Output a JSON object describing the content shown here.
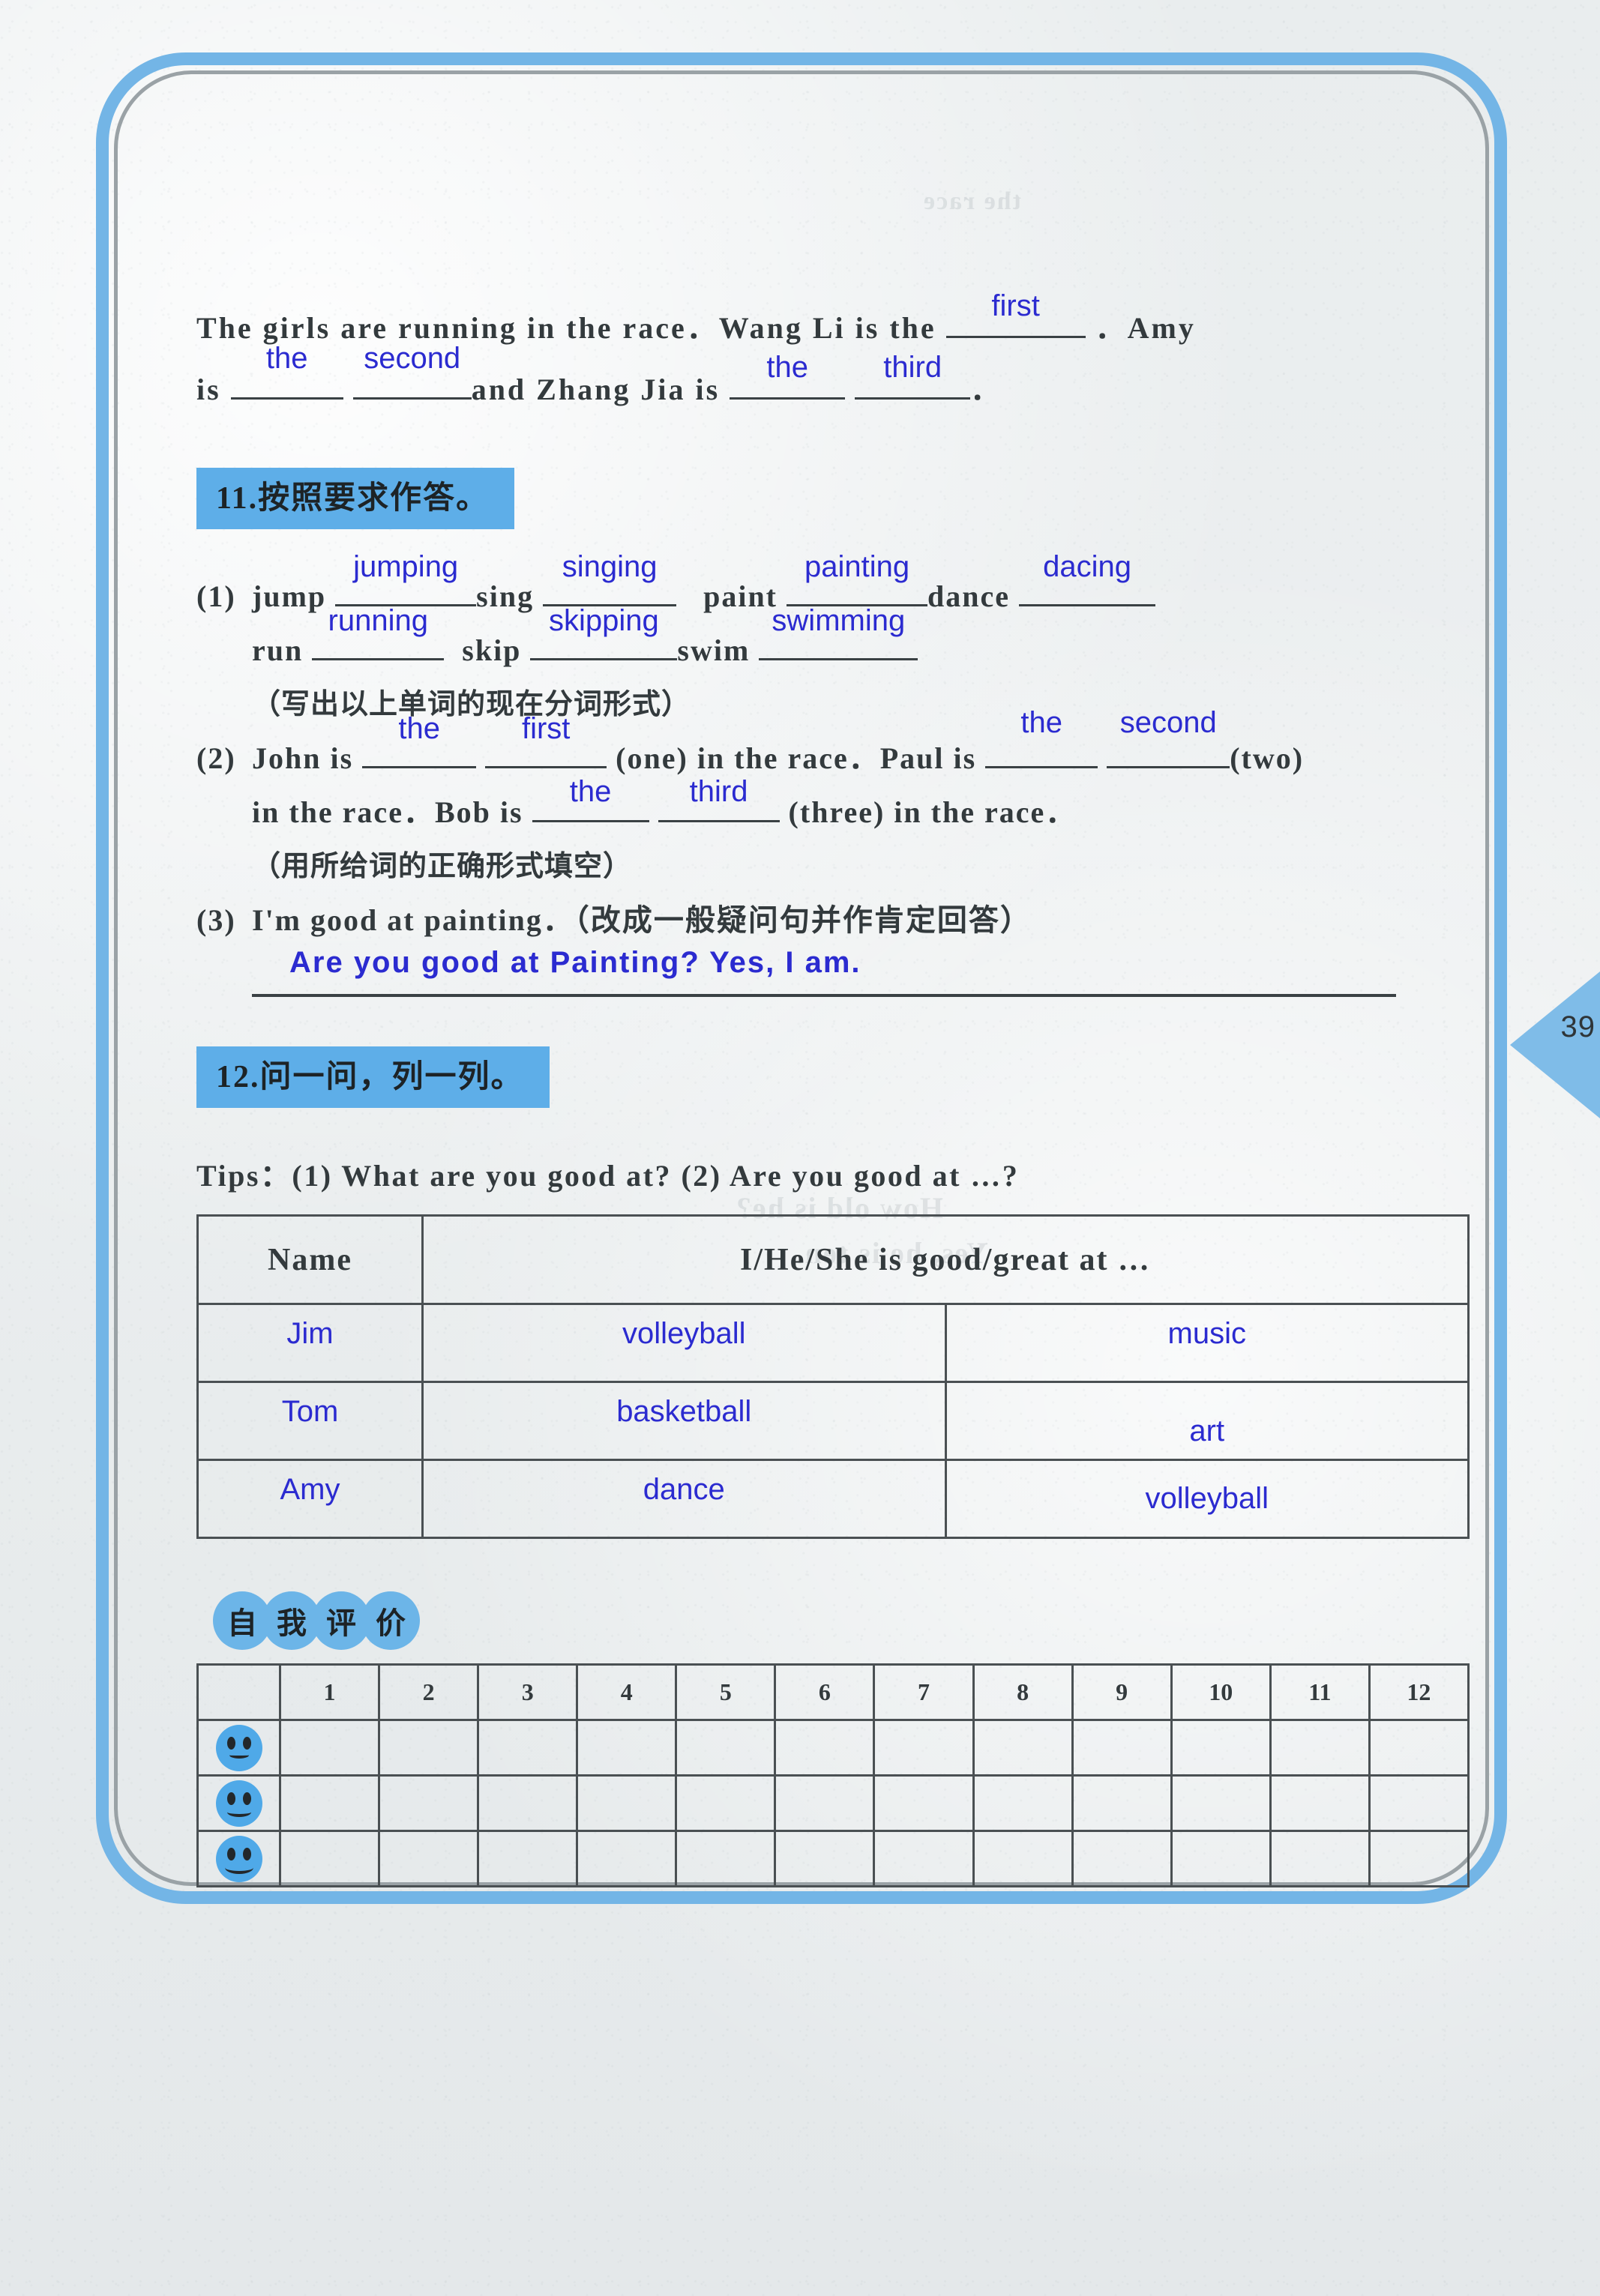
{
  "page": {
    "number": "39"
  },
  "bleed_text": {
    "line1": "How old is he?",
    "line2": "Yes, he is ten.",
    "line3": "the race"
  },
  "intro": {
    "seg1": "The girls are running in the race．Wang Li is the",
    "blank1": "first",
    "seg2": "．Amy",
    "seg3": "is",
    "blank2": "the",
    "blank3": "second",
    "seg4": "and Zhang Jia is",
    "blank4": "the",
    "blank5": "third",
    "seg5": "．"
  },
  "section11": {
    "banner": "11.按照要求作答。",
    "q1": {
      "num": "(1)",
      "prompts_line1": [
        {
          "word": "jump",
          "answer": "jumping"
        },
        {
          "word": "sing",
          "answer": "singing"
        },
        {
          "word": "paint",
          "answer": "painting"
        },
        {
          "word": "dance",
          "answer": "dacing"
        }
      ],
      "prompts_line2": [
        {
          "word": "run",
          "answer": "running"
        },
        {
          "word": "skip",
          "answer": "skipping"
        },
        {
          "word": "swim",
          "answer": "swimming"
        }
      ],
      "instruction": "（写出以上单词的现在分词形式）"
    },
    "q2": {
      "num": "(2)",
      "seg1": "John is",
      "blank1": "the",
      "blank2": "first",
      "seg2": "(one) in the race．Paul is",
      "blank3": "the",
      "blank4": "second",
      "seg3": "(two)",
      "seg4": "in the race．Bob is",
      "blank5": "the",
      "blank6": "third",
      "seg5": "(three) in the race．",
      "instruction": "（用所给词的正确形式填空）"
    },
    "q3": {
      "num": "(3)",
      "text": "I'm good at painting．（改成一般疑问句并作肯定回答）",
      "answer": "Are you good at Painting? Yes, I am."
    }
  },
  "section12": {
    "banner": "12.问一问，列一列。",
    "tips": "Tips：(1) What are you good at? (2) Are you good at …?",
    "table": {
      "headers": [
        "Name",
        "I/He/She is good/great at …"
      ],
      "rows": [
        {
          "name": "Jim",
          "col1": "volleyball",
          "col2": "music"
        },
        {
          "name": "Tom",
          "col1": "basketball",
          "col2": "art"
        },
        {
          "name": "Amy",
          "col1": "dance",
          "col2": "volleyball"
        }
      ]
    }
  },
  "self_eval": {
    "label_chars": [
      "自",
      "我",
      "评",
      "价"
    ],
    "numbers": [
      "1",
      "2",
      "3",
      "4",
      "5",
      "6",
      "7",
      "8",
      "9",
      "10",
      "11",
      "12"
    ],
    "face_rows": [
      "smiley-slight",
      "smiley-medium",
      "smiley-wide"
    ]
  },
  "colors": {
    "accent_blue": "#5eaee8",
    "handwriting_blue": "#2b2bd0",
    "ink": "#333a3d",
    "frame_blue": "#73b5e6"
  }
}
